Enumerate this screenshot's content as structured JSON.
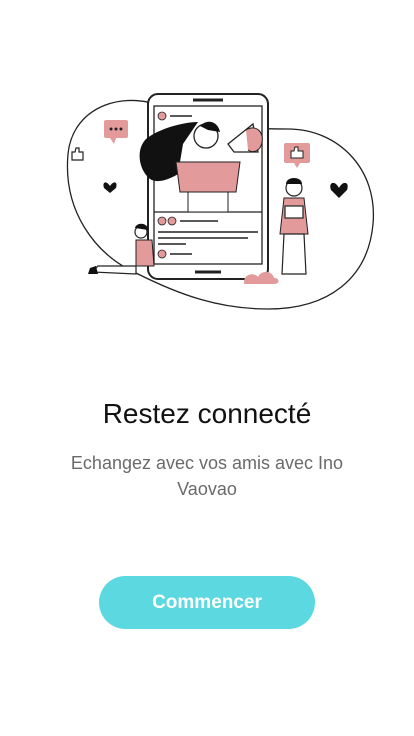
{
  "onboarding": {
    "illustration": {
      "icon_names": [
        "phone-icon",
        "megaphone-woman-icon",
        "chat-bubble-icon",
        "like-icon",
        "heart-icon",
        "person-with-laptop-icon",
        "cloud-icon"
      ],
      "accent_color": "#e29a9a"
    },
    "title": "Restez connecté",
    "subtitle": "Echangez avec vos amis avec Ino Vaovao",
    "button_label": "Commencer",
    "button_color": "#5bd8e0"
  }
}
